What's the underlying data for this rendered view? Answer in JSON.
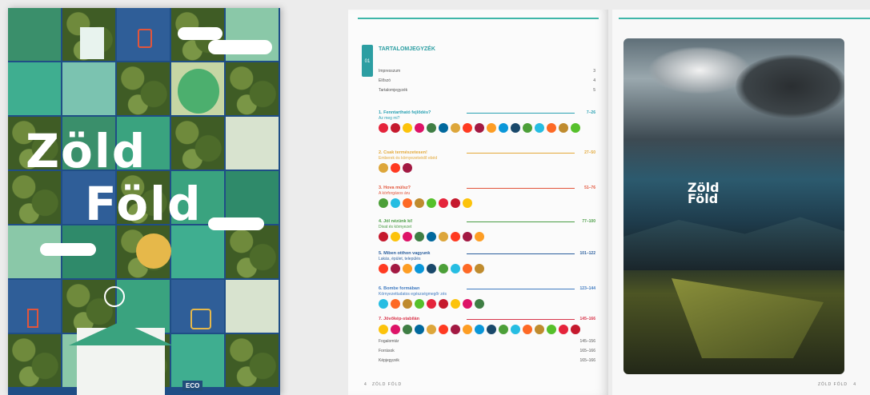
{
  "cover": {
    "title_line1": "Zöld",
    "title_line2": "Föld",
    "badge": "ECO"
  },
  "toc": {
    "section_number": "01",
    "heading": "TARTALOMJEGYZÉK",
    "front_matter": [
      {
        "label": "Impresszum",
        "page": "3"
      },
      {
        "label": "Előszó",
        "page": "4"
      },
      {
        "label": "Tartalomjegyzék",
        "page": "5"
      }
    ],
    "chapters": [
      {
        "title": "1. Fenntartható fejlődés?",
        "subtitle": "Az meg mi?",
        "pages": "7–26",
        "color": "#2aa1b3"
      },
      {
        "title": "2. Csak természetesen!",
        "subtitle": "Emberek és környezetvédő ebéd",
        "pages": "27–50",
        "color": "#e3a93a"
      },
      {
        "title": "3. Hova múlsz?",
        "subtitle": "A körforgásos áru",
        "pages": "51–76",
        "color": "#e2553b"
      },
      {
        "title": "4. Jól nézünk ki!",
        "subtitle": "Divat és környezet",
        "pages": "77–100",
        "color": "#4a9d45"
      },
      {
        "title": "5. Miben otthon vagyunk",
        "subtitle": "Lakás, épület, település",
        "pages": "101–122",
        "color": "#2b5f9e"
      },
      {
        "title": "6. Bombe formában",
        "subtitle": "Környezettudatos egészségmegőr zés",
        "pages": "123–144",
        "color": "#3f7ac0"
      },
      {
        "title": "7. Jövőkép-stabilán",
        "subtitle": "",
        "pages": "145–166",
        "color": "#d8344a"
      }
    ],
    "back_matter": [
      {
        "label": "Fogalomtár",
        "page": "145–156"
      },
      {
        "label": "Források",
        "page": "165–166"
      },
      {
        "label": "Képjegyzék",
        "page": "165–166"
      }
    ],
    "footer_page": "4",
    "footer_text": "ZÖLD FÖLD"
  },
  "photo_page": {
    "title_line1": "Zöld",
    "title_line2": "Föld",
    "footer_text": "ZÖLD FÖLD",
    "footer_page": "4"
  },
  "sdg_colors": [
    "#e5243b",
    "#dda63a",
    "#4c9f38",
    "#c5192d",
    "#ff3a21",
    "#26bde2",
    "#fcc30b",
    "#a21942",
    "#fd6925",
    "#dd1367",
    "#fd9d24",
    "#bf8b2e",
    "#3f7e44",
    "#0a97d9",
    "#56c02b",
    "#00689d",
    "#19486a"
  ]
}
